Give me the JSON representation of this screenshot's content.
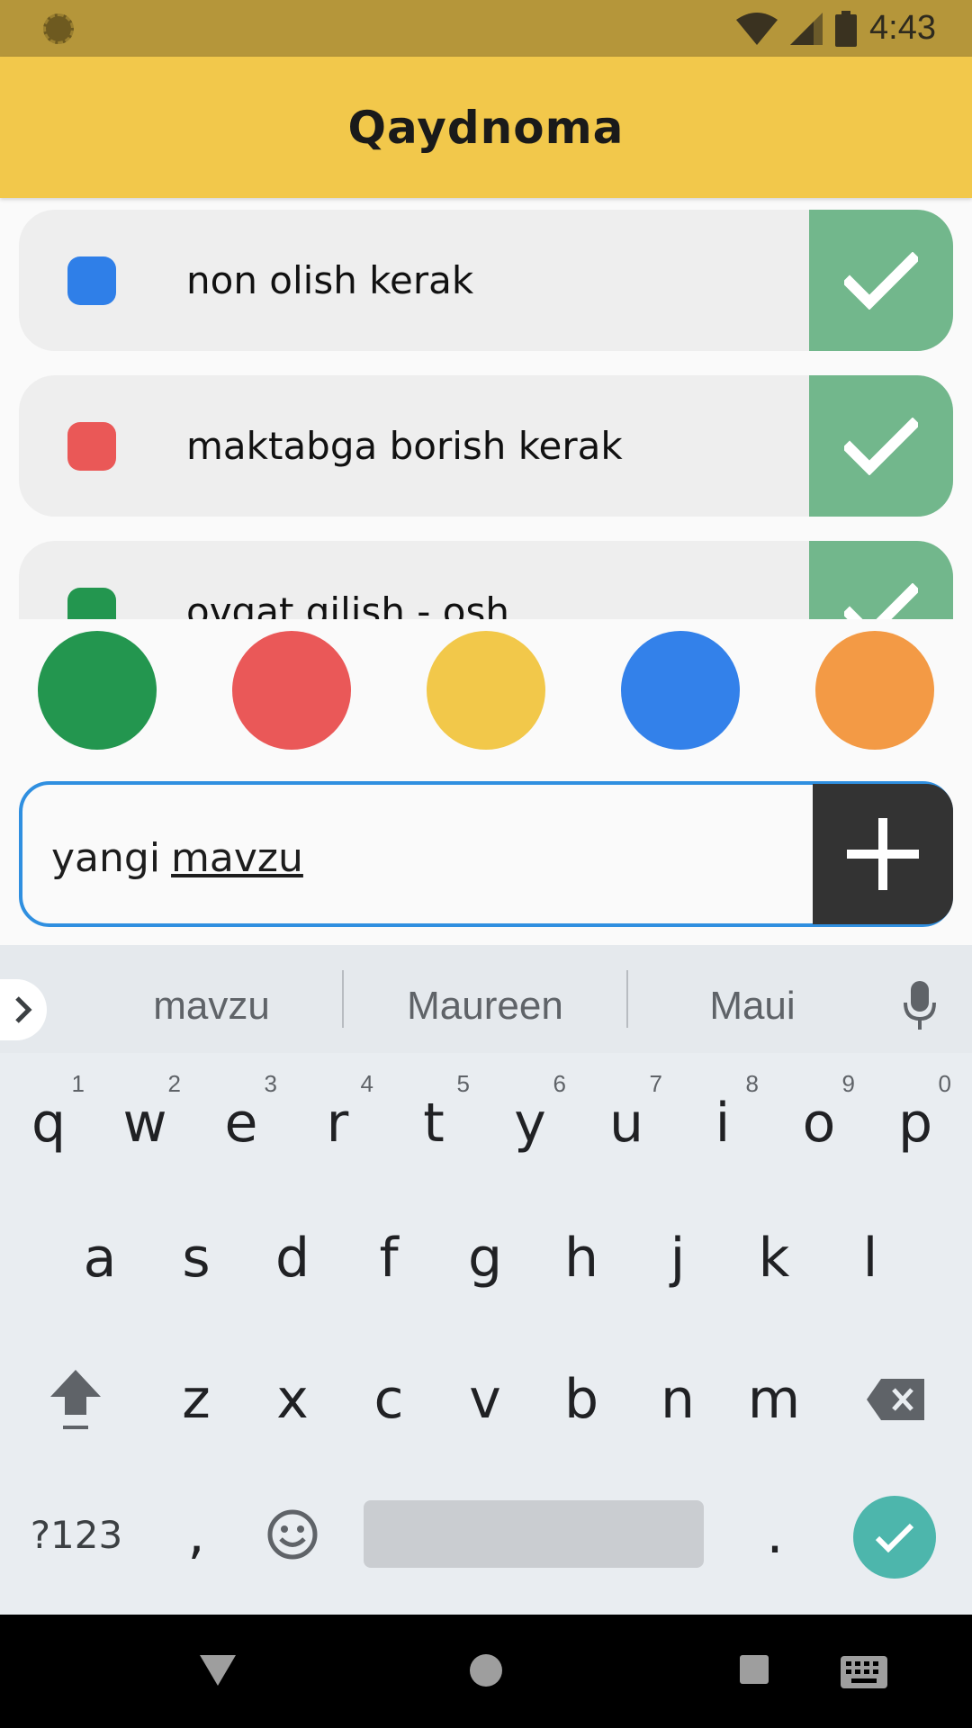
{
  "status_bar": {
    "time": "4:43"
  },
  "app_bar": {
    "title": "Qaydnoma"
  },
  "todos": [
    {
      "text": "non olish kerak",
      "color": "#2f7fe8"
    },
    {
      "text": "maktabga borish kerak",
      "color": "#ea5857"
    },
    {
      "text": "ovqat qilish - osh",
      "color": "#23964f"
    }
  ],
  "color_picker": [
    "#23964f",
    "#ea5858",
    "#f2c84a",
    "#3381ea",
    "#f39a45"
  ],
  "input": {
    "typed": "yangi",
    "composing": "mavzu"
  },
  "keyboard": {
    "suggestions": [
      "mavzu",
      "Maureen",
      "Maui"
    ],
    "row1": [
      {
        "key": "q",
        "num": "1"
      },
      {
        "key": "w",
        "num": "2"
      },
      {
        "key": "e",
        "num": "3"
      },
      {
        "key": "r",
        "num": "4"
      },
      {
        "key": "t",
        "num": "5"
      },
      {
        "key": "y",
        "num": "6"
      },
      {
        "key": "u",
        "num": "7"
      },
      {
        "key": "i",
        "num": "8"
      },
      {
        "key": "o",
        "num": "9"
      },
      {
        "key": "p",
        "num": "0"
      }
    ],
    "row2": [
      "a",
      "s",
      "d",
      "f",
      "g",
      "h",
      "j",
      "k",
      "l"
    ],
    "row3": [
      "z",
      "x",
      "c",
      "v",
      "b",
      "n",
      "m"
    ],
    "symbols_label": "?123",
    "comma_label": ",",
    "period_label": "."
  },
  "colors": {
    "app_bar": "#f2c84b",
    "status_bar": "#b5963a",
    "check_bg": "#72b78c",
    "add_bg": "#333333",
    "input_border": "#2f8fe0"
  }
}
